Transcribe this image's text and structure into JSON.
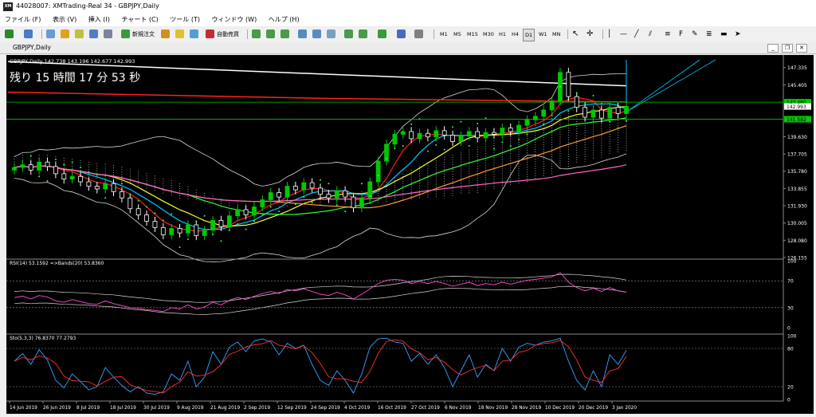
{
  "window": {
    "title": "44028007: XMTrading-Real 34 - GBPJPY,Daily",
    "app_icon": "XM"
  },
  "menu": [
    "ファイル (F)",
    "表示 (V)",
    "挿入 (I)",
    "チャート (C)",
    "ツール (T)",
    "ウィンドウ (W)",
    "ヘルプ (H)"
  ],
  "toolbar": {
    "new_order": "新規注文",
    "auto_trade": "自動売買",
    "timeframes": [
      "M1",
      "M5",
      "M15",
      "M30",
      "H1",
      "H4",
      "D1",
      "W1",
      "MN"
    ],
    "active_timeframe": "D1"
  },
  "chart_window": {
    "title": "GBPJPY,Daily"
  },
  "chart_data": {
    "type": "line",
    "symbol_header": "GBPJPY,Daily  142.738 143.196 142.677 142.993",
    "countdown": "残り 15 時間 17 分 53 秒",
    "price_axis": [
      "147.335",
      "145.405",
      "143.480",
      "142.993",
      "141.582",
      "139.630",
      "137.705",
      "135.780",
      "133.855",
      "131.930",
      "130.005",
      "128.080",
      "126.155"
    ],
    "price_tags": [
      {
        "label": "143.480",
        "value": 143.48,
        "color": "#00c800"
      },
      {
        "label": "142.993",
        "value": 142.993,
        "color": "#ffffff"
      },
      {
        "label": "141.582",
        "value": 141.582,
        "color": "#00c800"
      }
    ],
    "ylim": [
      126.155,
      148.2
    ],
    "close_series": [
      136.2,
      136.5,
      135.9,
      136.8,
      136.3,
      135.5,
      134.9,
      135.2,
      134.6,
      134.1,
      133.8,
      134.4,
      133.5,
      132.8,
      131.6,
      130.9,
      130.2,
      129.5,
      128.7,
      129.4,
      128.9,
      129.8,
      128.6,
      129.2,
      130.3,
      129.6,
      130.8,
      131.5,
      130.9,
      131.8,
      132.6,
      133.4,
      132.9,
      134.1,
      133.7,
      134.5,
      133.9,
      133.2,
      132.8,
      133.6,
      132.9,
      131.7,
      132.8,
      134.6,
      136.9,
      138.8,
      139.9,
      140.2,
      139.4,
      140.0,
      139.6,
      140.3,
      139.8,
      139.1,
      139.7,
      140.2,
      139.5,
      140.1,
      139.9,
      140.6,
      140.2,
      140.9,
      141.5,
      141.9,
      142.6,
      143.6,
      146.8,
      144.1,
      142.9,
      141.8,
      142.6,
      141.7,
      142.9,
      142.2,
      142.993
    ],
    "rsi": {
      "header": "RSI(14) 53.1592  =>Bands(20) 53.8360",
      "levels": [
        100,
        70,
        30,
        0
      ],
      "values": [
        45,
        47,
        43,
        48,
        46,
        40,
        38,
        42,
        39,
        36,
        35,
        40,
        36,
        33,
        30,
        29,
        27,
        26,
        24,
        30,
        28,
        34,
        28,
        31,
        38,
        34,
        41,
        45,
        42,
        47,
        51,
        54,
        51,
        57,
        55,
        58,
        54,
        50,
        48,
        53,
        49,
        43,
        50,
        58,
        66,
        71,
        72,
        71,
        66,
        69,
        66,
        69,
        66,
        62,
        65,
        68,
        63,
        66,
        64,
        68,
        65,
        68,
        71,
        72,
        74,
        76,
        82,
        68,
        60,
        55,
        59,
        54,
        60,
        55,
        53
      ]
    },
    "stoch": {
      "header": "Sto(5,3,3) 76.8370 77.2793",
      "levels": [
        100,
        80,
        20,
        0
      ],
      "main": [
        60,
        72,
        55,
        78,
        62,
        30,
        18,
        40,
        28,
        15,
        20,
        50,
        35,
        22,
        12,
        20,
        10,
        8,
        12,
        40,
        30,
        60,
        20,
        35,
        75,
        55,
        82,
        90,
        75,
        92,
        95,
        90,
        70,
        88,
        80,
        85,
        55,
        30,
        22,
        45,
        30,
        10,
        40,
        82,
        95,
        96,
        90,
        88,
        60,
        72,
        55,
        70,
        50,
        20,
        45,
        70,
        35,
        55,
        45,
        80,
        60,
        82,
        88,
        85,
        90,
        92,
        96,
        60,
        30,
        15,
        45,
        20,
        70,
        55,
        77
      ]
    },
    "dates": [
      "14 Jun 2019",
      "26 Jun 2019",
      "8 Jul 2019",
      "18 Jul 2019",
      "30 Jul 2019",
      "9 Aug 2019",
      "21 Aug 2019",
      "2 Sep 2019",
      "12 Sep 2019",
      "24 Sep 2019",
      "4 Oct 2019",
      "16 Oct 2019",
      "27 Oct 2019",
      "6 Nov 2019",
      "18 Nov 2019",
      "28 Nov 2019",
      "10 Dec 2019",
      "20 Dec 2019",
      "3 Jan 2020"
    ]
  },
  "colors": {
    "bg": "#000000",
    "bull": "#00c800",
    "bear": "#ffffff",
    "rsi": "#ff4ccf",
    "stoch_main": "#3aa0ff",
    "stoch_signal": "#ff3030"
  }
}
